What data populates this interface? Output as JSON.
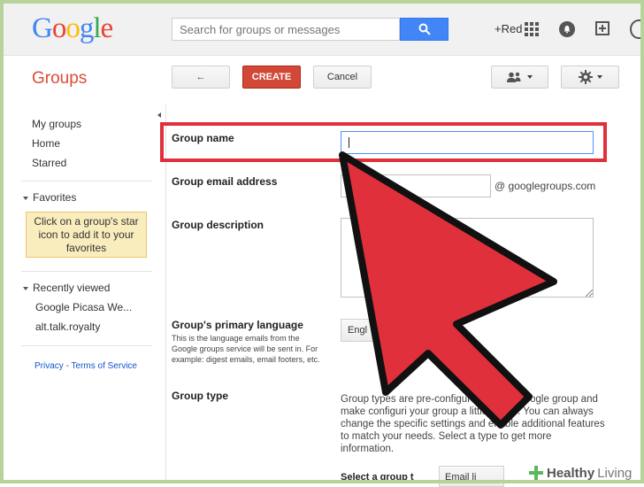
{
  "header": {
    "logo_letters": [
      {
        "char": "G",
        "color": "#4285f4"
      },
      {
        "char": "o",
        "color": "#ea4335"
      },
      {
        "char": "o",
        "color": "#fbbc05"
      },
      {
        "char": "g",
        "color": "#4285f4"
      },
      {
        "char": "l",
        "color": "#34a853"
      },
      {
        "char": "e",
        "color": "#ea4335"
      }
    ],
    "search_placeholder": "Search for groups or messages",
    "plus_name": "+Red",
    "icons": [
      "search-icon",
      "apps-grid-icon",
      "notifications-icon",
      "share-icon"
    ]
  },
  "app_title": "Groups",
  "toolbar": {
    "back_icon": "←",
    "create_label": "CREATE",
    "cancel_label": "Cancel"
  },
  "sidebar": {
    "nav": [
      "My groups",
      "Home",
      "Starred"
    ],
    "favorites_label": "Favorites",
    "favorites_note": "Click on a group's star icon to add it to your favorites",
    "recently_viewed_label": "Recently viewed",
    "recent": [
      "Google Picasa We...",
      "alt.talk.royalty"
    ],
    "footer": {
      "privacy": "Privacy",
      "separator": " - ",
      "terms": "Terms of Service"
    }
  },
  "form": {
    "group_name_label": "Group name",
    "group_name_value": "",
    "email_label": "Group email address",
    "email_suffix": "@ googlegroups.com",
    "description_label": "Group description",
    "language_label": "Group's primary language",
    "language_help": "This is the language emails from the Google groups service will be sent in. For example: digest emails, email footers, etc.",
    "language_value": "Engl",
    "group_type_label": "Group type",
    "group_type_text": "Group types are pre-configure        for your Google group and make configuri  your group a little easier. You can always change the specific settings and enable additional features to match your needs. Select a type to get more information.",
    "select_type_label": "Select a group t",
    "select_type_value": "Email li"
  },
  "colors": {
    "brand_red": "#dd4b39",
    "create_button": "#d14836",
    "search_button": "#4285f4",
    "highlight": "#e0303c",
    "arrow_fill": "#e0303c"
  },
  "watermark": {
    "brand": "Healthy",
    "suffix": "Living"
  }
}
